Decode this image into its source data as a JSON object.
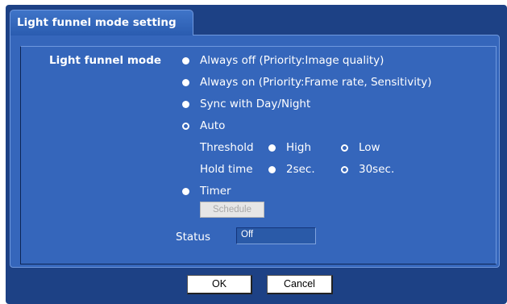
{
  "tab": {
    "title": "Light funnel mode setting"
  },
  "form": {
    "mode_label": "Light funnel mode",
    "options": [
      {
        "label": "Always off (Priority:Image quality)",
        "checked": false
      },
      {
        "label": "Always on (Priority:Frame rate, Sensitivity)",
        "checked": false
      },
      {
        "label": "Sync with Day/Night",
        "checked": false
      },
      {
        "label": "Auto",
        "checked": true
      },
      {
        "label": "Timer",
        "checked": false
      }
    ],
    "threshold": {
      "label": "Threshold",
      "options": [
        {
          "label": "High",
          "checked": false
        },
        {
          "label": "Low",
          "checked": true
        }
      ]
    },
    "hold_time": {
      "label": "Hold time",
      "options": [
        {
          "label": "2sec.",
          "checked": false
        },
        {
          "label": "30sec.",
          "checked": true
        }
      ]
    },
    "schedule_button": "Schedule",
    "status_label": "Status",
    "status_value": "Off"
  },
  "footer": {
    "ok": "OK",
    "cancel": "Cancel"
  }
}
